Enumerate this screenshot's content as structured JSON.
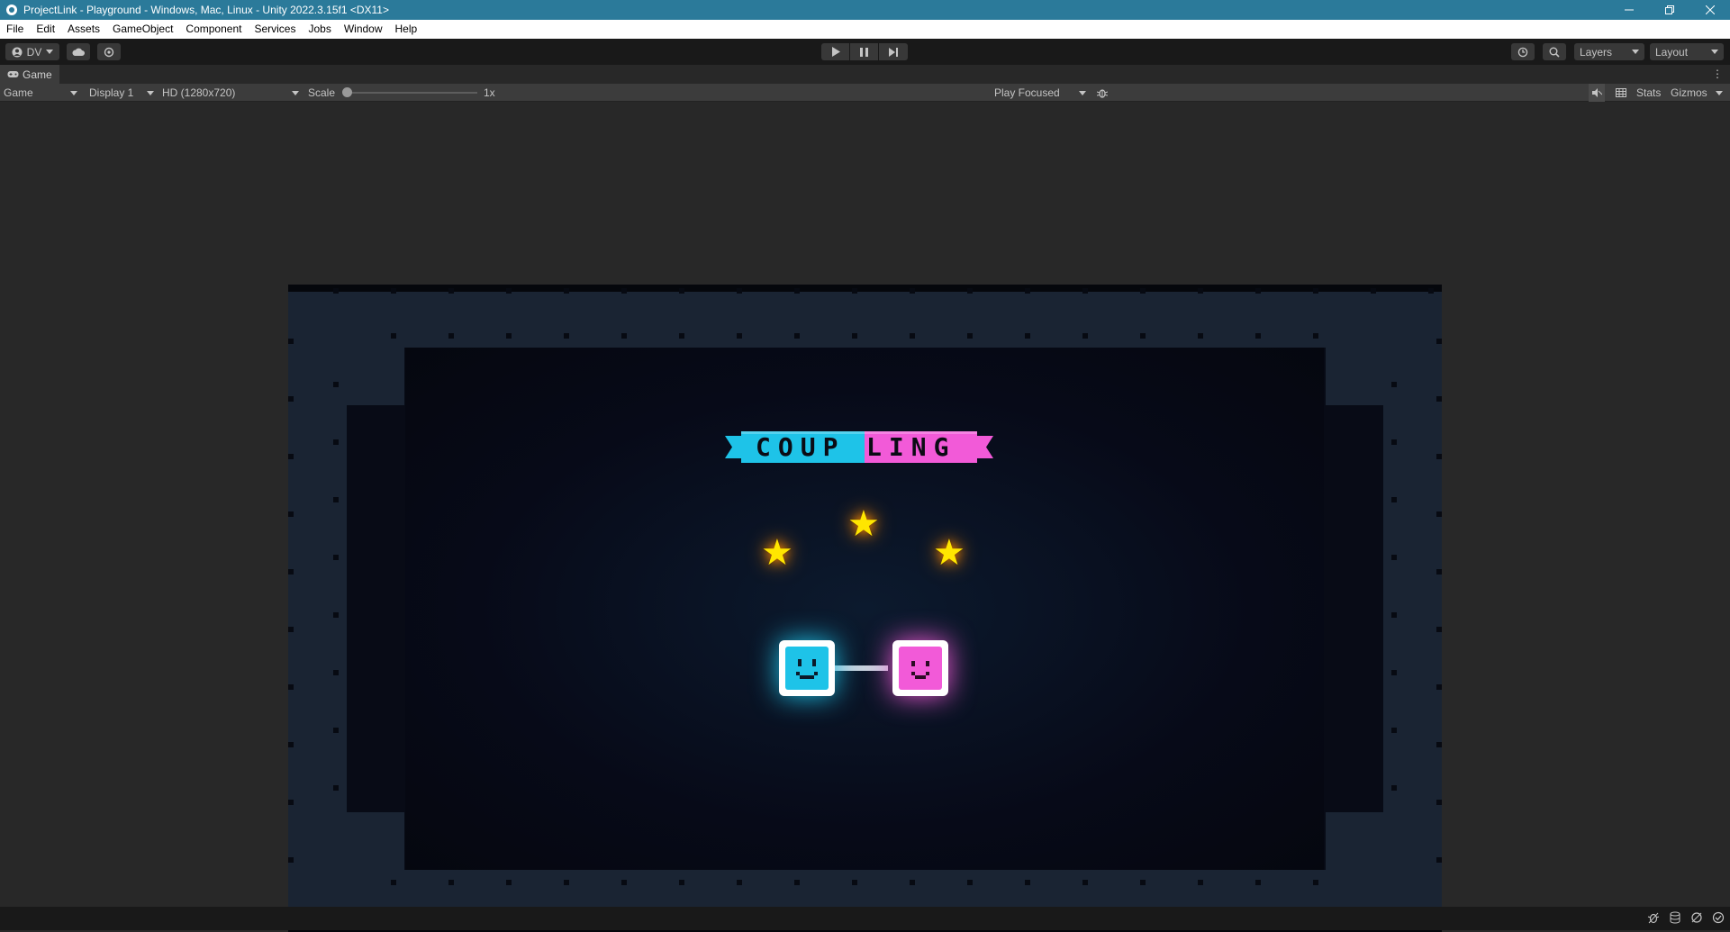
{
  "window": {
    "title": "ProjectLink - Playground - Windows, Mac, Linux - Unity 2022.3.15f1 <DX11>",
    "app_icon": "unity-logo-icon",
    "controls": [
      "minimize-icon",
      "restore-icon",
      "close-icon"
    ]
  },
  "menu": [
    "File",
    "Edit",
    "Assets",
    "GameObject",
    "Component",
    "Services",
    "Jobs",
    "Window",
    "Help"
  ],
  "toolbar": {
    "account_label": "DV",
    "cloud_icon": "cloud-icon",
    "collab_icon": "collab-icon",
    "play_icon": "play-icon",
    "pause_icon": "pause-icon",
    "step_icon": "step-icon",
    "history_icon": "history-icon",
    "search_icon": "search-icon",
    "layers_label": "Layers",
    "layout_label": "Layout"
  },
  "tab": {
    "label": "Game",
    "icon": "gamepad-icon"
  },
  "game_toolbar": {
    "view_select": "Game",
    "display_select": "Display 1",
    "resolution_select": "HD (1280x720)",
    "scale_label": "Scale",
    "scale_value": "1x",
    "scale_fraction": 0.0,
    "play_mode_select": "Play Focused",
    "bug_icon": "bug-icon",
    "audio_icon": "audio-mute-icon",
    "grid_icon": "grid-icon",
    "stats_label": "Stats",
    "gizmos_label": "Gizmos"
  },
  "game": {
    "title_part1": "COUP",
    "title_part2": "LING",
    "stars_count": 3,
    "colors": {
      "cyan": "#1ec3e8",
      "magenta": "#f25ad8",
      "star": "#ffe600"
    }
  },
  "statusbar": {
    "icons": [
      "debug-icon",
      "cache-icon",
      "auto-gen-lighting-icon",
      "check-icon"
    ]
  }
}
